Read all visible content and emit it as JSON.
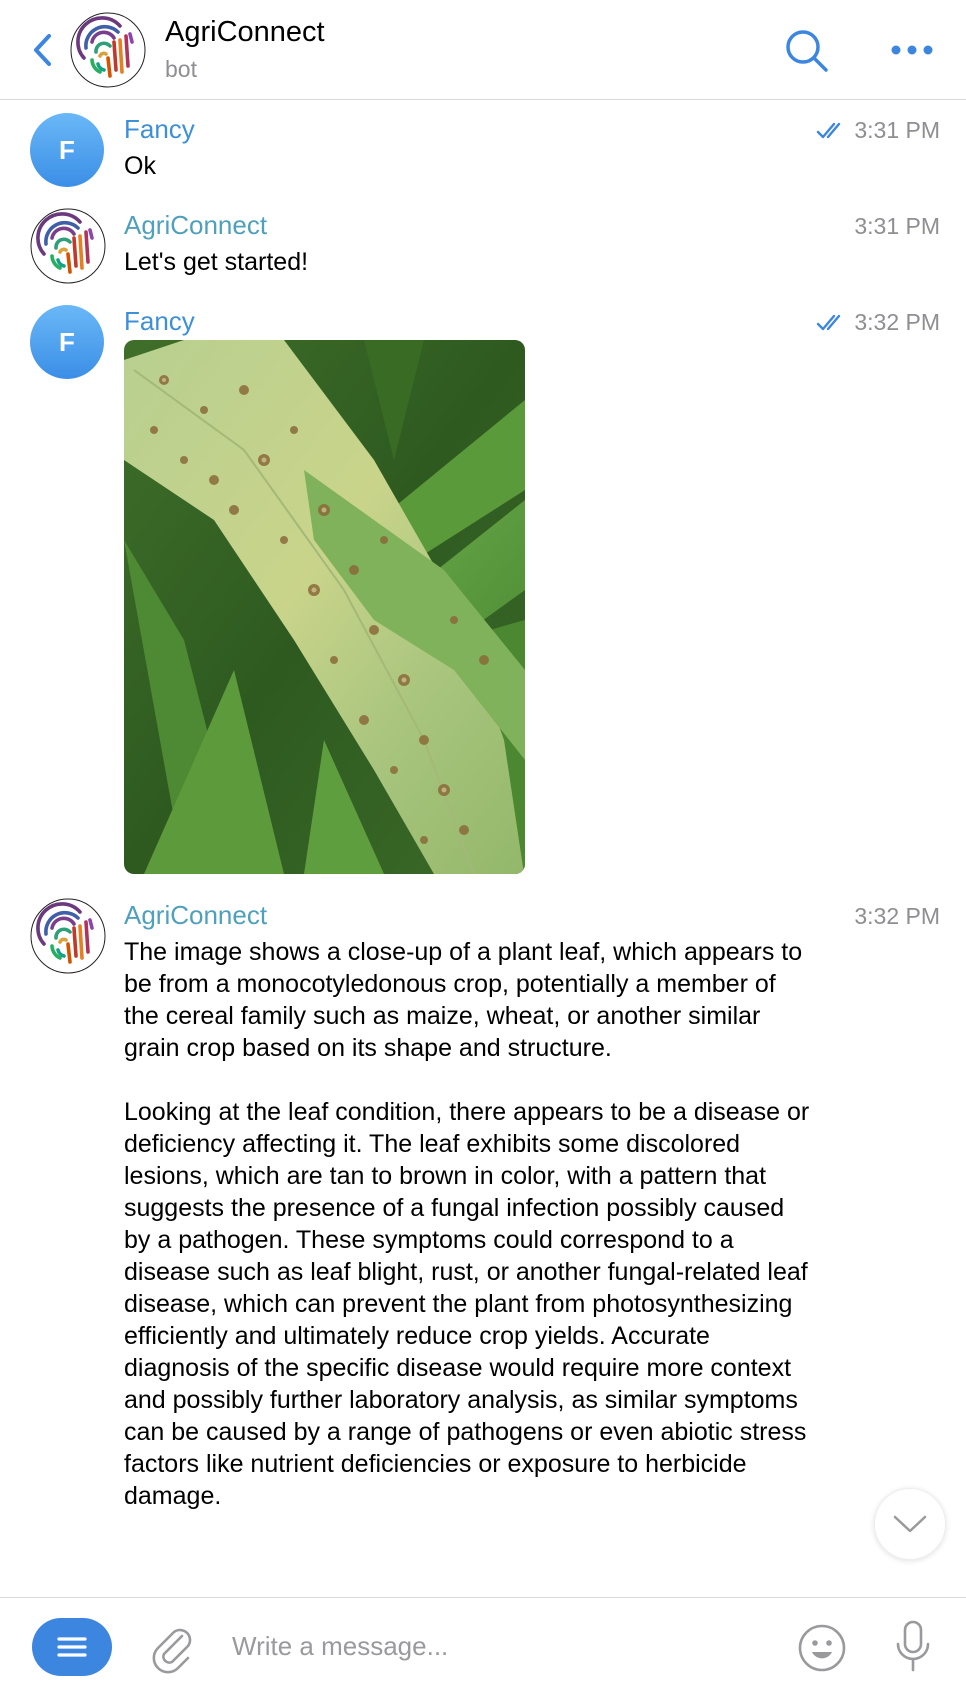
{
  "header": {
    "title": "AgriConnect",
    "subtitle": "bot"
  },
  "messages": [
    {
      "sender": "Fancy",
      "avatar_letter": "F",
      "time": "3:31 PM",
      "read": true,
      "text": "Ok"
    },
    {
      "sender": "AgriConnect",
      "time": "3:31 PM",
      "read": false,
      "text": "Let's get started!"
    },
    {
      "sender": "Fancy",
      "avatar_letter": "F",
      "time": "3:32 PM",
      "read": true,
      "image": "plant-leaf-photo"
    },
    {
      "sender": "AgriConnect",
      "time": "3:32 PM",
      "read": false,
      "text": "The image shows a close-up of a plant leaf, which appears to be from a monocotyledonous crop, potentially a member of the cereal family such as maize, wheat, or another similar grain crop based on its shape and structure.\n\nLooking at the leaf condition, there appears to be a disease or deficiency affecting it. The leaf exhibits some discolored lesions, which are tan to brown in color, with a pattern that suggests the presence of a fungal infection possibly caused by a pathogen. These symptoms could correspond to a disease such as leaf blight, rust, or another fungal-related leaf disease, which can prevent the plant from photosynthesizing efficiently and ultimately reduce crop yields. Accurate diagnosis of the specific disease would require more context and possibly further laboratory analysis, as similar symptoms can be caused by a range of pathogens or even abiotic stress factors like nutrient deficiencies or exposure to herbicide damage."
    }
  ],
  "composer": {
    "placeholder": "Write a message..."
  },
  "colors": {
    "accent": "#3d86e0",
    "user_name": "#3d8fd6",
    "bot_name": "#4fa0bd",
    "time": "#8e8e93"
  },
  "icons": [
    "back-chevron-icon",
    "search-icon",
    "more-dots-icon",
    "double-check-icon",
    "chevron-down-icon",
    "menu-lines-icon",
    "paperclip-icon",
    "smiley-icon",
    "microphone-icon"
  ]
}
